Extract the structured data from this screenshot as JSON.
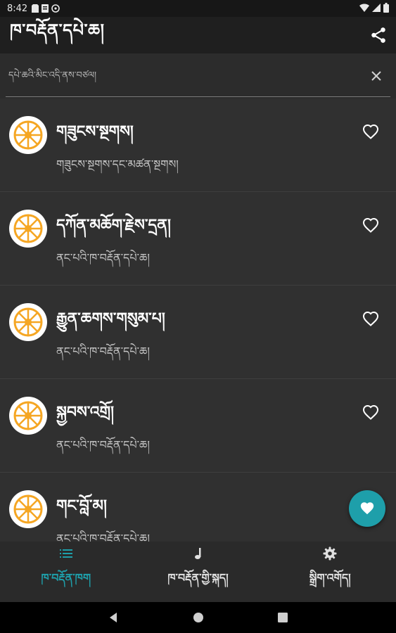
{
  "status_bar": {
    "time": "8:42"
  },
  "app_bar": {
    "title": "ཁ་བརྡོན་དཔེ་ཆ།"
  },
  "search": {
    "placeholder": "དཔེ་ཆའི་མིང་འདི་ནས་བཙལ།"
  },
  "items": [
    {
      "title": "གཟུངས་སྔགས།",
      "subtitle": "གཟུངས་སྔགས་དང་མཚན་སྔགས།"
    },
    {
      "title": "དཀོན་མཆོག་རྗེས་དྲན།",
      "subtitle": "ནང་པའི་ཁ་བརྡོན་དཔེ་ཆ།"
    },
    {
      "title": "རྒྱུན་ཆགས་གསུམ་པ།",
      "subtitle": "ནང་པའི་ཁ་བརྡོན་དཔེ་ཆ།"
    },
    {
      "title": "སྐྱབས་འགྲོ།",
      "subtitle": "ནང་པའི་ཁ་བརྡོན་དཔེ་ཆ།"
    },
    {
      "title": "གང་བློ་མ།",
      "subtitle": "ནང་པའི་ཁ་བརྡོན་དཔེ་ཆ།"
    }
  ],
  "bottom_nav": [
    {
      "label": "ཁ་བརྡོན་ཁག",
      "icon": "list-icon",
      "active": true
    },
    {
      "label": "ཁ་བརྡོན་གྱི་སྐད།",
      "icon": "music-note-icon",
      "active": false
    },
    {
      "label": "སྒྲིག་འགོད།",
      "icon": "gear-icon",
      "active": false
    }
  ],
  "colors": {
    "accent": "#1e9faa",
    "wheel": "#f5a623",
    "background": "#303030",
    "app_bar": "#1f1f1f"
  }
}
